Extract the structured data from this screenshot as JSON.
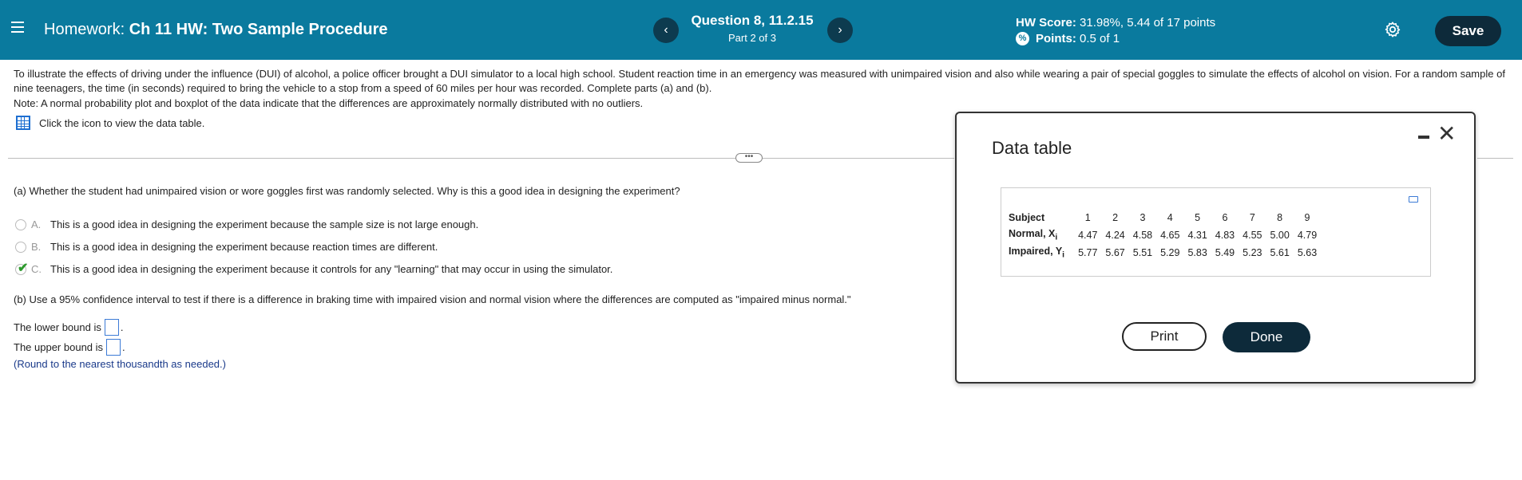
{
  "header": {
    "hw_prefix": "Homework:",
    "hw_title": "Ch 11 HW: Two Sample Procedure",
    "prev_label": "‹",
    "next_label": "›",
    "question_title": "Question 8, 11.2.15",
    "question_part": "Part 2 of 3",
    "hw_score_label": "HW Score:",
    "hw_score_value": "31.98%, 5.44 of 17 points",
    "points_label": "Points:",
    "points_value": "0.5 of 1",
    "save_label": "Save",
    "colors": {
      "bar": "#0a7a9e",
      "button": "#0d2a3a"
    }
  },
  "question": {
    "intro": "To illustrate the effects of driving under the influence (DUI) of alcohol, a police officer brought a DUI simulator to a local high school. Student reaction time in an emergency was measured with unimpaired vision and also while wearing a pair of special goggles to simulate the effects of alcohol on vision. For a random sample of nine teenagers, the time (in seconds) required to bring the vehicle to a stop from a speed of 60 miles per hour was recorded. Complete parts (a) and (b).",
    "note": "Note: A normal probability plot and boxplot of the data indicate that the differences are approximately normally distributed with no outliers.",
    "click_icon_text": "Click the icon to view the data table.",
    "expander_label": "•••",
    "part_a": "(a) Whether the student had unimpaired vision or wore goggles first was randomly selected. Why is this a good idea in designing the experiment?",
    "options": [
      {
        "letter": "A.",
        "text": "This is a good idea in designing the experiment because the sample size is not large enough."
      },
      {
        "letter": "B.",
        "text": "This is a good idea in designing the experiment because reaction times are different."
      },
      {
        "letter": "C.",
        "text": "This is a good idea in designing the experiment because it controls for any \"learning\" that may occur in using the simulator."
      }
    ],
    "selected_option": "C.",
    "part_b": "(b) Use a 95% confidence interval to test if there is a difference in braking time with impaired vision and normal vision where the differences are computed as \"impaired minus normal.\"",
    "lower_bound_label": "The lower bound is",
    "upper_bound_label": "The upper bound is",
    "lower_bound_value": "",
    "upper_bound_value": "",
    "round_note": "(Round to the nearest thousandth as needed.)"
  },
  "modal": {
    "title": "Data table",
    "minimize_label": "—",
    "close_label": "✕",
    "table": {
      "row_headers": [
        "Subject",
        "Normal, X",
        "Impaired, Y"
      ],
      "subscript": "i",
      "subjects": [
        "1",
        "2",
        "3",
        "4",
        "5",
        "6",
        "7",
        "8",
        "9"
      ],
      "normal": [
        "4.47",
        "4.24",
        "4.58",
        "4.65",
        "4.31",
        "4.83",
        "4.55",
        "5.00",
        "4.79"
      ],
      "impaired": [
        "5.77",
        "5.67",
        "5.51",
        "5.29",
        "5.83",
        "5.49",
        "5.23",
        "5.61",
        "5.63"
      ]
    },
    "print_label": "Print",
    "done_label": "Done"
  }
}
